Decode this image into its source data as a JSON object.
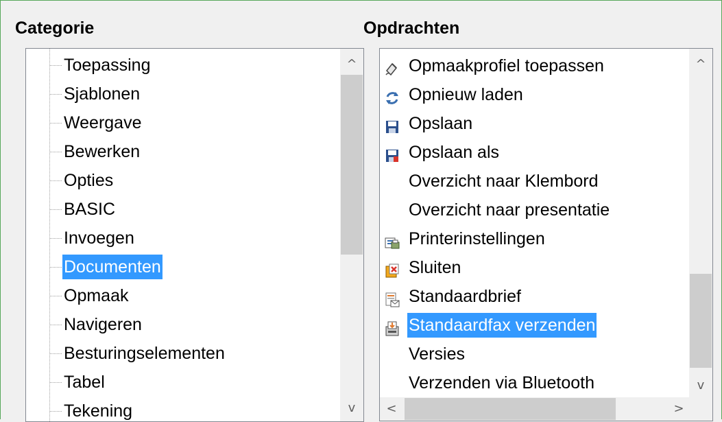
{
  "category": {
    "heading": "Categorie",
    "items": [
      {
        "label": "Toepassing"
      },
      {
        "label": "Sjablonen"
      },
      {
        "label": "Weergave"
      },
      {
        "label": "Bewerken"
      },
      {
        "label": "Opties"
      },
      {
        "label": "BASIC"
      },
      {
        "label": "Invoegen"
      },
      {
        "label": "Documenten",
        "selected": true
      },
      {
        "label": "Opmaak"
      },
      {
        "label": "Navigeren"
      },
      {
        "label": "Besturingselementen"
      },
      {
        "label": "Tabel"
      },
      {
        "label": "Tekening"
      }
    ],
    "scroll_up": "^",
    "scroll_down": "v"
  },
  "commands": {
    "heading": "Opdrachten",
    "items": [
      {
        "label": "Opmaakprofiel toepassen",
        "icon": "apply-style-icon"
      },
      {
        "label": "Opnieuw laden",
        "icon": "reload-icon"
      },
      {
        "label": "Opslaan",
        "icon": "save-icon"
      },
      {
        "label": "Opslaan als",
        "icon": "save-as-icon"
      },
      {
        "label": "Overzicht naar Klembord",
        "icon": ""
      },
      {
        "label": "Overzicht naar presentatie",
        "icon": ""
      },
      {
        "label": "Printerinstellingen",
        "icon": "printer-settings-icon"
      },
      {
        "label": "Sluiten",
        "icon": "close-document-icon"
      },
      {
        "label": "Standaardbrief",
        "icon": "mail-merge-icon"
      },
      {
        "label": "Standaardfax verzenden",
        "icon": "send-fax-icon",
        "selected": true
      },
      {
        "label": "Versies",
        "icon": ""
      },
      {
        "label": "Verzenden via Bluetooth",
        "icon": ""
      }
    ],
    "scroll_up": "^",
    "scroll_down": "v",
    "scroll_left": "<",
    "scroll_right": ">"
  },
  "colors": {
    "selection": "#3399ff",
    "frame_border": "#58a85a",
    "scrollbar_track": "#f0f0f0",
    "scrollbar_thumb": "#cdcdcd"
  }
}
